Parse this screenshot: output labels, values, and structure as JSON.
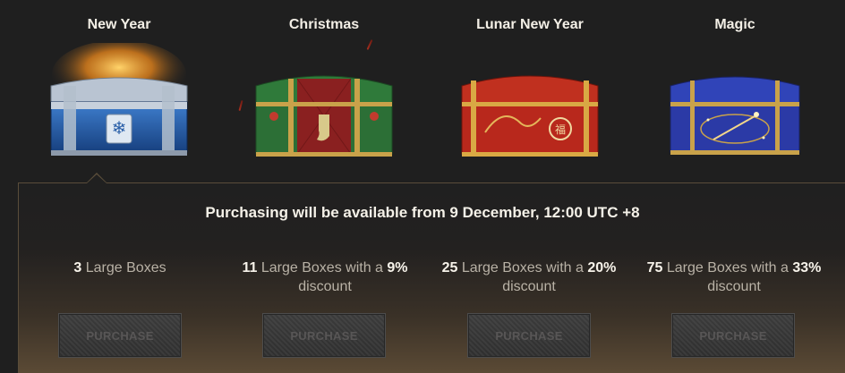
{
  "boxes": [
    {
      "title": "New Year"
    },
    {
      "title": "Christmas"
    },
    {
      "title": "Lunar New Year"
    },
    {
      "title": "Magic"
    }
  ],
  "availability_text": "Purchasing will be available from 9 December, 12:00 UTC +8",
  "offers": [
    {
      "count": "3",
      "text": " Large Boxes",
      "discount": "",
      "line2": ""
    },
    {
      "count": "11",
      "text": " Large Boxes with a ",
      "discount": "9%",
      "line2": "discount"
    },
    {
      "count": "25",
      "text": " Large Boxes with a ",
      "discount": "20%",
      "line2": "discount"
    },
    {
      "count": "75",
      "text": " Large Boxes with a ",
      "discount": "33%",
      "line2": "discount"
    }
  ],
  "purchase_label": "PURCHASE",
  "colors": {
    "new_year": "#2a5fa8",
    "christmas": "#2f7a3a",
    "lunar": "#b8281c",
    "magic": "#2b3aa6",
    "gold": "#c9a24a"
  }
}
